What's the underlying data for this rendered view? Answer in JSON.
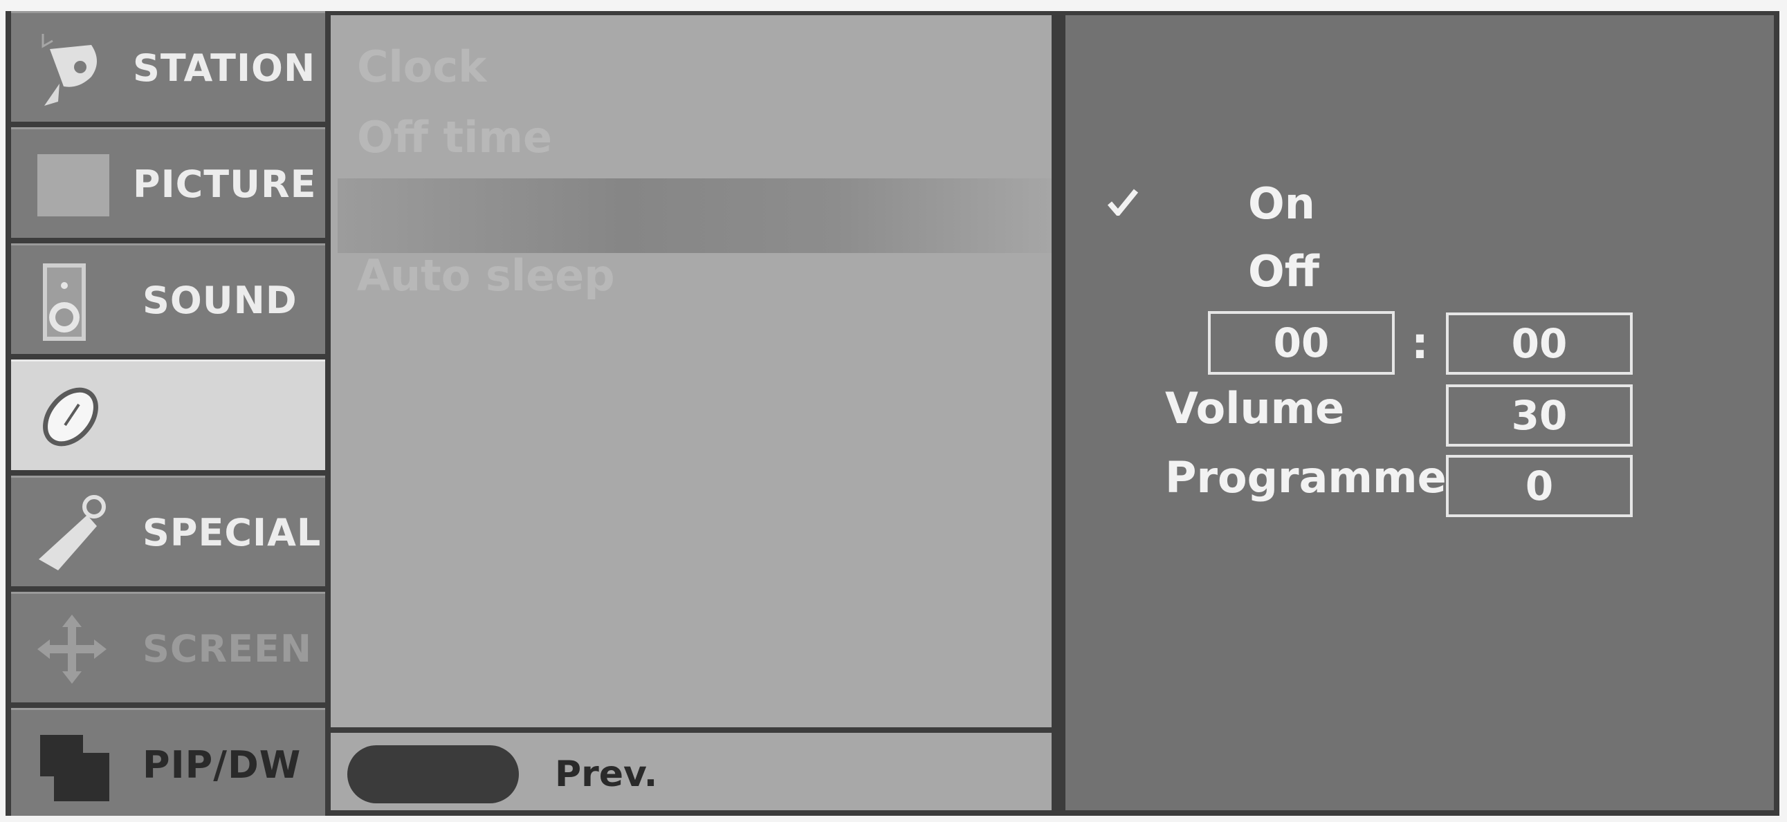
{
  "menu": {
    "items": [
      {
        "id": "station",
        "label": "STATION",
        "icon": "satellite-dish-icon"
      },
      {
        "id": "picture",
        "label": "PICTURE",
        "icon": "picture-square-icon"
      },
      {
        "id": "sound",
        "label": "SOUND",
        "icon": "speaker-icon"
      },
      {
        "id": "time",
        "label": "",
        "icon": "clock-icon",
        "selected": true
      },
      {
        "id": "special",
        "label": "SPECIAL",
        "icon": "key-tag-icon"
      },
      {
        "id": "screen",
        "label": "SCREEN",
        "icon": "move-arrows-icon"
      },
      {
        "id": "pipdw",
        "label": "PIP/DW",
        "icon": "overlapping-squares-icon"
      }
    ]
  },
  "submenu": {
    "items": [
      "Clock",
      "Off time",
      "",
      "Auto sleep"
    ]
  },
  "footer": {
    "prev_label": "Prev."
  },
  "options": {
    "on_label": "On",
    "off_label": "Off",
    "time_hours": "00",
    "time_separator": ":",
    "time_minutes": "00",
    "volume_label": "Volume",
    "volume_value": "30",
    "programme_label": "Programme",
    "programme_value": "0"
  },
  "colors": {
    "menu_bg": "#7b7b7b",
    "menu_selected_bg": "#d6d6d6",
    "submenu_bg": "#a9a9a9",
    "option_panel_bg": "#727272"
  }
}
